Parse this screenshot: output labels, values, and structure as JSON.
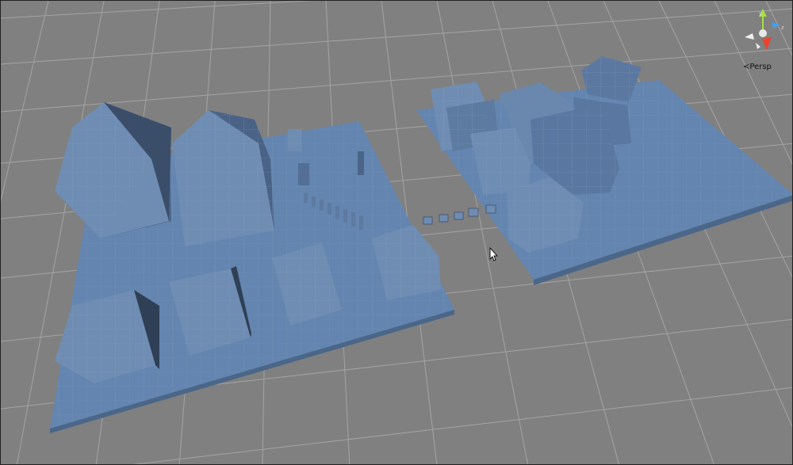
{
  "viewport": {
    "background": "#808080",
    "grid_color": "#a9a9a9",
    "grid_major_color": "#bdbdbd"
  },
  "gizmo": {
    "projection_label": "Persp",
    "axis_labels": {
      "y": "y",
      "z": "z"
    },
    "colors": {
      "x": "#e8442e",
      "y": "#a7e043",
      "z": "#3ea2f5",
      "neutral": "#f0f0f0",
      "center": "#e8e8e8"
    }
  },
  "scene": {
    "mesh_color": "#6b88ad",
    "mesh_shadow": "#3b4f69",
    "platform_color": "#6385b0",
    "icons": {
      "cursor": "arrow-cursor-icon"
    }
  }
}
